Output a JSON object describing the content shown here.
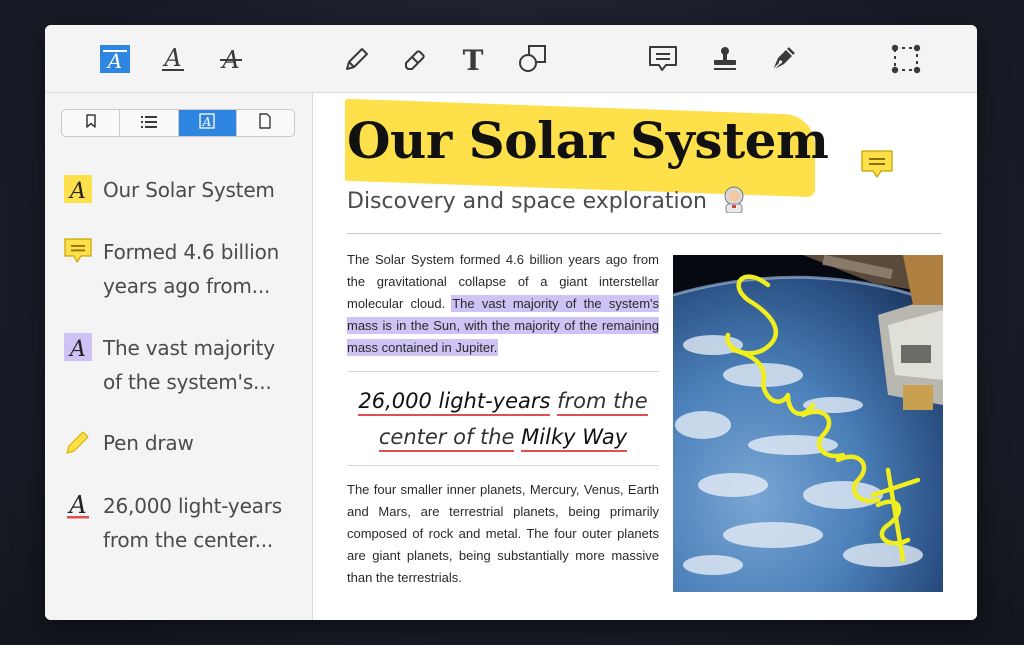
{
  "toolbar": {
    "tools": [
      {
        "name": "highlight-tool-icon",
        "active": true
      },
      {
        "name": "underline-tool-icon"
      },
      {
        "name": "strikethrough-tool-icon"
      },
      {
        "name": "pencil-icon"
      },
      {
        "name": "eraser-icon"
      },
      {
        "name": "text-tool-icon"
      },
      {
        "name": "shapes-icon"
      },
      {
        "name": "comment-icon"
      },
      {
        "name": "stamp-icon"
      },
      {
        "name": "signature-pen-icon"
      },
      {
        "name": "selection-icon"
      }
    ],
    "glyph_a": "A",
    "glyph_t": "T"
  },
  "sidebar": {
    "tabs": [
      {
        "name": "bookmark-icon"
      },
      {
        "name": "list-icon"
      },
      {
        "name": "annotations-icon",
        "active": true,
        "glyph": "A"
      },
      {
        "name": "page-icon"
      }
    ],
    "annotations": [
      {
        "type": "highlight",
        "line1": "Our Solar System",
        "line2": "",
        "color": "#fde04a",
        "glyph": "A"
      },
      {
        "type": "note",
        "line1": "Formed 4.6 billion",
        "line2": "years ago from...",
        "color": "#fde04a"
      },
      {
        "type": "highlight",
        "line1": "The vast majority",
        "line2": "of the system's...",
        "color": "#cfc2f5",
        "glyph": "A"
      },
      {
        "type": "pen",
        "line1": "Pen draw",
        "line2": "",
        "color": "#fde04a"
      },
      {
        "type": "underline",
        "line1": "26,000 light-years",
        "line2": "from the center...",
        "color": "#e05050",
        "glyph": "A"
      }
    ]
  },
  "document": {
    "title": "Our Solar System",
    "subtitle": "Discovery and space exploration",
    "para1_plain": "The Solar System formed 4.6 billion years ago from the gravitational collapse of a giant interstellar molecular cloud.",
    "para1_highlight": "The vast majority of the system's mass is in the Sun, with the majority of the remaining mass contained in Jupiter.",
    "quote": {
      "part1": "26,000 light-years",
      "part2": "from the",
      "part3": "center of the",
      "part4": "Milky Way"
    },
    "para2": "The four smaller inner planets, Mercury, Venus, Earth and Mars, are terrestrial planets, being primarily composed of rock and metal. The four outer planets are giant planets, being substantially more massive than the terrestrials.",
    "handwriting": "Sweet"
  },
  "colors": {
    "accent": "#2f86e0",
    "highlight_yellow": "#fde04a",
    "highlight_purple": "#cfc2f5",
    "underline_red": "#e05050",
    "handwriting_yellow": "#f0ee1e"
  }
}
